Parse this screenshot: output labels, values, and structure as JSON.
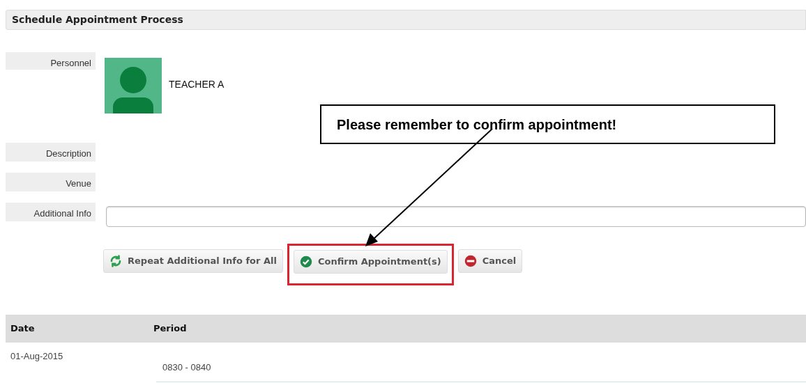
{
  "panel": {
    "title": "Schedule Appointment Process"
  },
  "form": {
    "personnel": {
      "label": "Personnel",
      "name": "TEACHER A"
    },
    "fields": [
      {
        "label": "Description"
      },
      {
        "label": "Venue"
      },
      {
        "label": "Additional Info",
        "kind": "input"
      }
    ]
  },
  "buttons": [
    {
      "label": "Repeat Additional Info for All",
      "kind": "repeat",
      "highlighted": false
    },
    {
      "label": "Confirm Appointment(s)",
      "kind": "confirm",
      "highlighted": true
    },
    {
      "label": "Cancel",
      "kind": "cancel",
      "highlighted": false
    }
  ],
  "callout": {
    "text": "Please remember to confirm appointment!"
  },
  "table": {
    "columns": [
      "Date",
      "Period"
    ],
    "rows": [
      {
        "date": "01-Aug-2015",
        "period": "0830 - 0840"
      }
    ]
  }
}
